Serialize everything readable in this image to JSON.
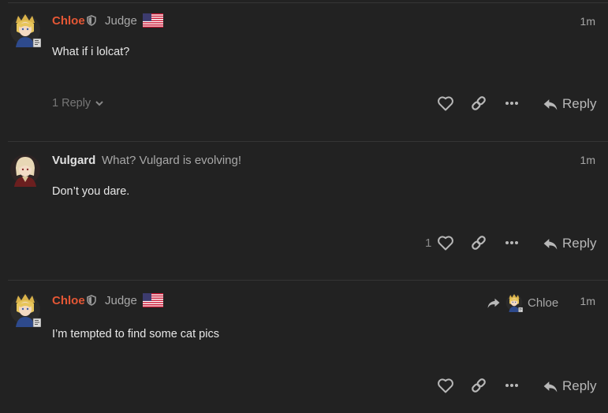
{
  "posts": [
    {
      "author": "Chloe",
      "user_title": "Judge",
      "time": "1m",
      "body": "What if i lolcat?",
      "replies_label": "1 Reply",
      "reply_label": "Reply"
    },
    {
      "author": "Vulgard",
      "user_title": "What? Vulgard is evolving!",
      "time": "1m",
      "body": "Don’t you dare.",
      "like_count": "1",
      "reply_label": "Reply"
    },
    {
      "author": "Chloe",
      "user_title": "Judge",
      "time": "1m",
      "body": "I’m tempted to find some cat pics",
      "reply_to_name": "Chloe",
      "reply_label": "Reply"
    }
  ],
  "colors": {
    "accent_name": "#e45735",
    "background": "#222222"
  },
  "icons": [
    "shield-icon",
    "us-flag-icon",
    "heart-icon",
    "link-icon",
    "more-icon",
    "reply-arrow-icon",
    "share-arrow-icon",
    "chevron-down-icon"
  ]
}
